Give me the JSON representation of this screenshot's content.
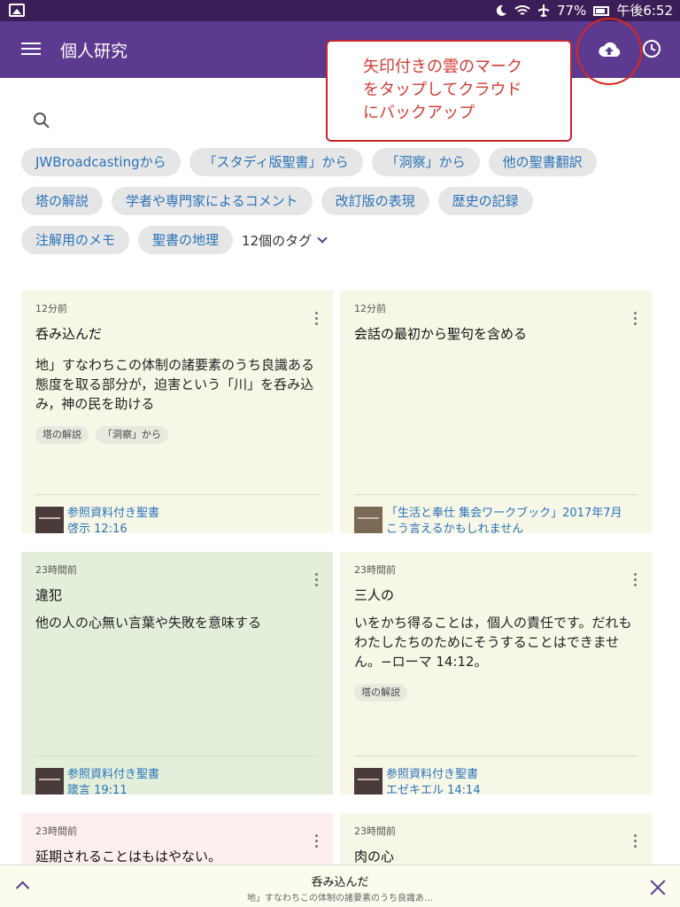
{
  "status_bar": {
    "battery": "77%",
    "time": "午後6:52"
  },
  "app_bar": {
    "title": "個人研究"
  },
  "annotation": {
    "line1": "矢印付きの雲のマーク",
    "line2": "をタップしてクラウド",
    "line3": "にバックアップ"
  },
  "tags": {
    "row1": [
      "JWBroadcastingから",
      "「スタディ版聖書」から",
      "「洞察」から",
      "他の聖書翻訳"
    ],
    "row2": [
      "塔の解説",
      "学者や専門家によるコメント",
      "改訂版の表現",
      "歴史の記録"
    ],
    "row3": [
      "注解用のメモ",
      "聖書の地理"
    ],
    "more_label": "12個のタグ"
  },
  "notes": [
    {
      "time": "12分前",
      "title": "呑み込んだ",
      "body": "地」すなわちこの体制の諸要素のうち良識ある態度を取る部分が，迫害という「川」を呑み込み，神の民を助ける",
      "tags": [
        "塔の解説",
        "「洞察」から"
      ],
      "ref_line1": "参照資料付き聖書",
      "ref_line2": "啓示 12:16"
    },
    {
      "time": "12分前",
      "title": "会話の最初から聖句を含める",
      "body": "",
      "tags": [],
      "ref_line1": "「生活と奉仕 集会ワークブック」2017年7月",
      "ref_line2": "こう言えるかもしれません"
    },
    {
      "time": "23時間前",
      "title": "違犯",
      "body": "他の人の心無い言葉や失敗を意味する",
      "tags": [],
      "ref_line1": "参照資料付き聖書",
      "ref_line2": "箴言 19:11"
    },
    {
      "time": "23時間前",
      "title": "三人の",
      "body": "いをかち得ることは，個人の責任です。だれもわたしたちのためにそうすることはできません。−ローマ 14:12。",
      "tags": [
        "塔の解説"
      ],
      "ref_line1": "参照資料付き聖書",
      "ref_line2": "エゼキエル 14:14"
    },
    {
      "time": "23時間前",
      "title": "延期されることはもはやない。",
      "body": "",
      "tags": [],
      "ref_line1": "",
      "ref_line2": ""
    },
    {
      "time": "23時間前",
      "title": "肉の心",
      "body": "",
      "tags": [],
      "ref_line1": "",
      "ref_line2": ""
    }
  ],
  "bottom_bar": {
    "title": "呑み込んだ",
    "subtitle": "地」すなわちこの体制の諸要素のうち良識あ…"
  },
  "colors": {
    "app_bar": "#5b3a8f",
    "status_bar": "#3b1d57",
    "note_yellow": "#f7f7e7",
    "note_green": "#e3efdb",
    "note_pink": "#fdeeee",
    "link": "#2a73b8",
    "annotation_red": "#d23a33"
  },
  "icons": {
    "menu": "hamburger-icon",
    "upload": "cloud-upload-icon",
    "history": "clock-icon",
    "search": "search-icon",
    "expand": "chevron-down-icon",
    "collapse": "chevron-up-icon",
    "close": "close-icon"
  }
}
